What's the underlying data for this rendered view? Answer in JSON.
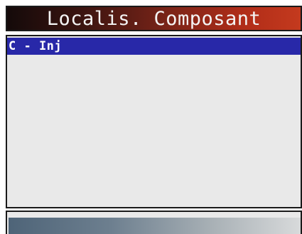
{
  "header": {
    "title": "Localis. Composant"
  },
  "component_list": {
    "items": [
      {
        "label": "C - Inj",
        "selected": true
      }
    ]
  },
  "colors": {
    "title_gradient_start": "#140a0a",
    "title_gradient_end": "#c43a1e",
    "selection": "#2828a8",
    "panel_background": "#e9e9e9",
    "footer_gradient_start": "#4e6478",
    "footer_gradient_end": "#d8dadb"
  }
}
